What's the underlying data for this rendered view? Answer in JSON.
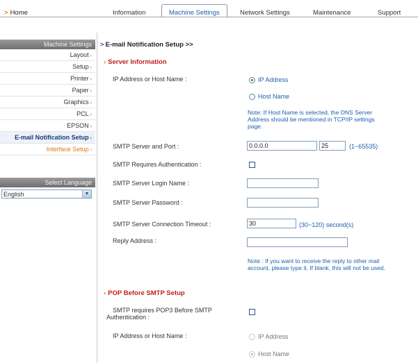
{
  "nav": {
    "home": "Home",
    "tabs": [
      {
        "label": "Information"
      },
      {
        "label": "Machine Settings"
      },
      {
        "label": "Network Settings"
      },
      {
        "label": "Maintenance"
      },
      {
        "label": "Support"
      }
    ]
  },
  "sidebar": {
    "header": "Machine Settings",
    "items": [
      {
        "label": "Layout"
      },
      {
        "label": "Setup"
      },
      {
        "label": "Printer"
      },
      {
        "label": "Paper"
      },
      {
        "label": "Graphics"
      },
      {
        "label": "PCL"
      },
      {
        "label": "EPSON"
      },
      {
        "label": "E-mail Notification Setup"
      },
      {
        "label": "Interface Setup"
      }
    ],
    "language_header": "Select Language",
    "language_value": "English"
  },
  "page": {
    "title": "E-mail Notification Setup >>",
    "server_section": "Server Information",
    "ip_host_label": "IP Address or Host Name :",
    "ip_option": "IP Address",
    "host_option": "Host Name",
    "host_note": "Note: If Host Name is selected, the DNS Server Address should be mentioned in TCP/IP settings page.",
    "smtp_server_label": "SMTP Server and Port :",
    "smtp_server_value": "0.0.0.0",
    "smtp_port_value": "25",
    "smtp_port_range": "(1~65535)",
    "smtp_auth_label": "SMTP Requires Authentication :",
    "smtp_login_label": "SMTP Server Login Name :",
    "smtp_login_value": "",
    "smtp_password_label": "SMTP Server Password :",
    "smtp_password_value": "",
    "smtp_timeout_label": "SMTP Server Connection Timeout :",
    "smtp_timeout_value": "30",
    "smtp_timeout_range": "(30~120) second(s)",
    "reply_label": "Reply Address :",
    "reply_value": "",
    "reply_note": "Note : If you want to receive the reply to other mail account, please type it. If blank, this will not be used.",
    "pop_section": "POP Before SMTP Setup",
    "pop_required_label": "SMTP requires POP3 Before SMTP Authentication :",
    "pop_ip_host_label": "IP Address or Host Name :",
    "pop_ip_option": "IP Address",
    "pop_host_option": "Host Name"
  },
  "colors": {
    "accent_blue": "#1b5fae",
    "section_red": "#c0201d",
    "arrow_orange": "#e07a10"
  }
}
